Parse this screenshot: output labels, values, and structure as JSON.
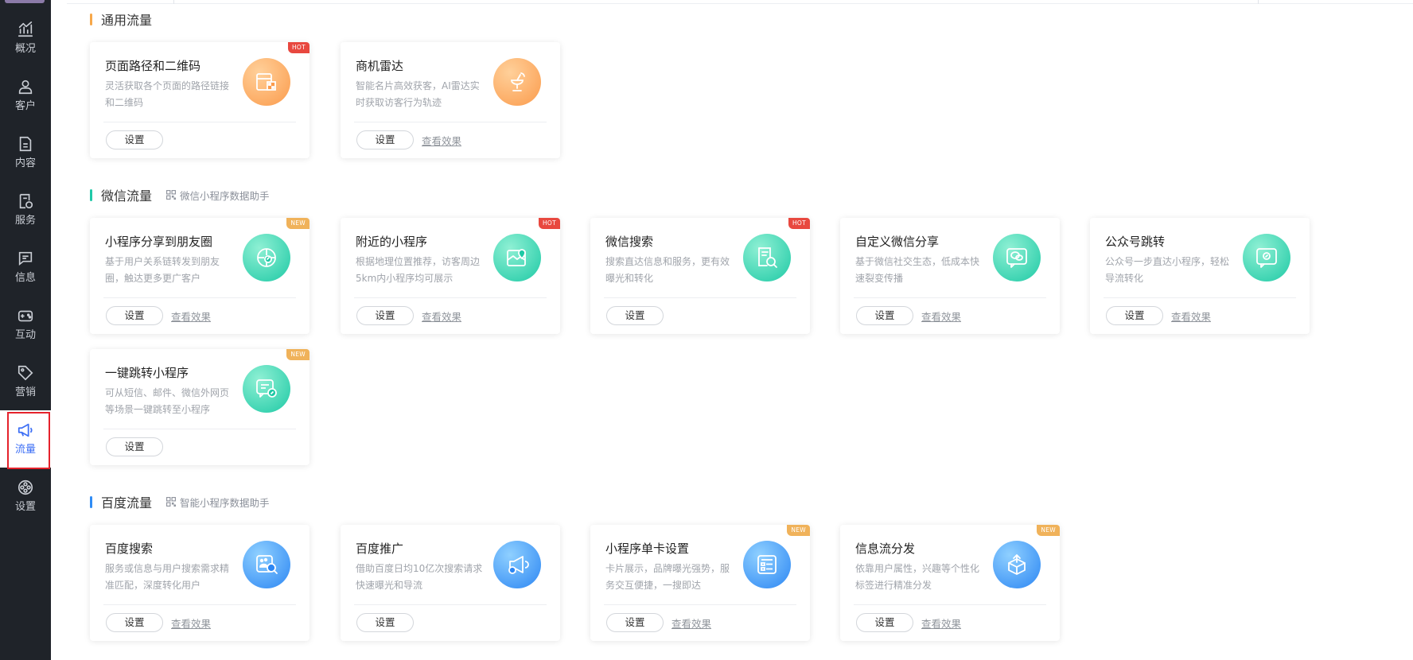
{
  "sidebar": {
    "items": [
      {
        "label": "概况",
        "icon": "chart-icon"
      },
      {
        "label": "客户",
        "icon": "user-icon"
      },
      {
        "label": "内容",
        "icon": "document-icon"
      },
      {
        "label": "服务",
        "icon": "service-icon"
      },
      {
        "label": "信息",
        "icon": "message-icon"
      },
      {
        "label": "互动",
        "icon": "interaction-icon"
      },
      {
        "label": "营销",
        "icon": "tag-icon"
      },
      {
        "label": "流量",
        "icon": "megaphone-icon",
        "active": true
      },
      {
        "label": "设置",
        "icon": "settings-icon"
      }
    ]
  },
  "sections": {
    "general": {
      "title": "通用流量",
      "accent": "#f7a84a",
      "cards": [
        {
          "title": "页面路径和二维码",
          "desc": "灵活获取各个页面的路径链接和二维码",
          "badge": "HOT",
          "icon": "page-qr-icon",
          "button": "设置"
        },
        {
          "title": "商机雷达",
          "desc": "智能名片高效获客，AI雷达实时获取访客行为轨迹",
          "icon": "radar-icon",
          "button": "设置",
          "link": "查看效果"
        }
      ]
    },
    "wechat": {
      "title": "微信流量",
      "helper": "微信小程序数据助手",
      "accent": "#20c9a8",
      "cards": [
        {
          "title": "小程序分享到朋友圈",
          "desc": "基于用户关系链转发到朋友圈，触达更多更广客户",
          "badge": "NEW",
          "icon": "moments-share-icon",
          "button": "设置",
          "link": "查看效果"
        },
        {
          "title": "附近的小程序",
          "desc": "根据地理位置推荐，访客周边5km内小程序均可展示",
          "badge": "HOT",
          "icon": "map-icon",
          "button": "设置",
          "link": "查看效果"
        },
        {
          "title": "微信搜索",
          "desc": "搜索直达信息和服务，更有效曝光和转化",
          "badge": "HOT",
          "icon": "search-doc-icon",
          "button": "设置"
        },
        {
          "title": "自定义微信分享",
          "desc": "基于微信社交生态，低成本快速裂变传播",
          "icon": "wechat-icon",
          "button": "设置",
          "link": "查看效果"
        },
        {
          "title": "公众号跳转",
          "desc": "公众号一步直达小程序，轻松导流转化",
          "icon": "official-account-icon",
          "button": "设置",
          "link": "查看效果"
        },
        {
          "title": "一键跳转小程序",
          "desc": "可从短信、邮件、微信外网页等场景一键跳转至小程序",
          "badge": "NEW",
          "icon": "jump-link-icon",
          "button": "设置"
        }
      ]
    },
    "baidu": {
      "title": "百度流量",
      "helper": "智能小程序数据助手",
      "accent": "#2f8cf5",
      "cards": [
        {
          "title": "百度搜索",
          "desc": "服务或信息与用户搜索需求精准匹配，深度转化用户",
          "icon": "baidu-search-icon",
          "button": "设置",
          "link": "查看效果"
        },
        {
          "title": "百度推广",
          "desc": "借助百度日均10亿次搜索请求快速曝光和导流",
          "icon": "baidu-promo-icon",
          "button": "设置"
        },
        {
          "title": "小程序单卡设置",
          "desc": "卡片展示，品牌曝光强势，服务交互便捷，一搜即达",
          "badge": "NEW",
          "icon": "card-list-icon",
          "button": "设置",
          "link": "查看效果"
        },
        {
          "title": "信息流分发",
          "desc": "依靠用户属性，兴趣等个性化标签进行精准分发",
          "badge": "NEW",
          "icon": "distribute-icon",
          "button": "设置",
          "link": "查看效果"
        }
      ]
    }
  }
}
